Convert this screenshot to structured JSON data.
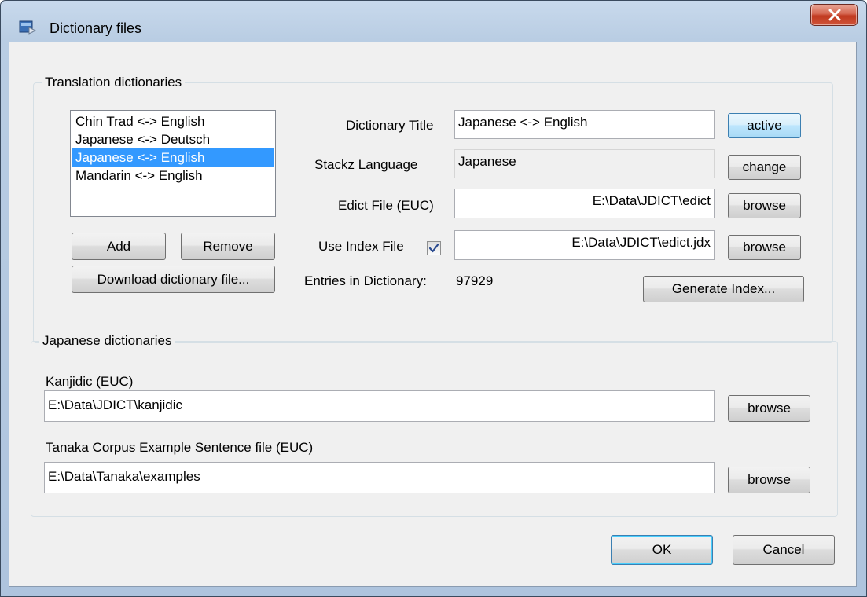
{
  "window": {
    "title": "Dictionary files",
    "icon": "app-icon",
    "close_icon": "close-icon"
  },
  "translation": {
    "group_label": "Translation dictionaries",
    "dictionaries": [
      "Chin Trad <-> English",
      "Japanese <-> Deutsch",
      "Japanese <-> English",
      "Mandarin <-> English"
    ],
    "selected_index": 2,
    "add_label": "Add",
    "remove_label": "Remove",
    "download_label": "Download dictionary file...",
    "title_label": "Dictionary Title",
    "title_value": "Japanese <-> English",
    "active_label": "active",
    "language_label": "Stackz Language",
    "language_value": "Japanese",
    "change_label": "change",
    "edict_label": "Edict File (EUC)",
    "edict_value": "E:\\Data\\JDICT\\edict",
    "browse_label": "browse",
    "index_label": "Use Index File",
    "index_checked": true,
    "index_value": "E:\\Data\\JDICT\\edict.jdx",
    "entries_label": "Entries in Dictionary:",
    "entries_value": "97929",
    "generate_label": "Generate Index..."
  },
  "japanese": {
    "group_label": "Japanese dictionaries",
    "kanjidic_label": "Kanjidic (EUC)",
    "kanjidic_value": "E:\\Data\\JDICT\\kanjidic",
    "tanaka_label": "Tanaka Corpus Example Sentence file (EUC)",
    "tanaka_value": "E:\\Data\\Tanaka\\examples",
    "browse_label": "browse"
  },
  "footer": {
    "ok_label": "OK",
    "cancel_label": "Cancel"
  },
  "colors": {
    "selection": "#3399ff",
    "close_button": "#c0391f",
    "checkmark": "#2a4a8f"
  }
}
